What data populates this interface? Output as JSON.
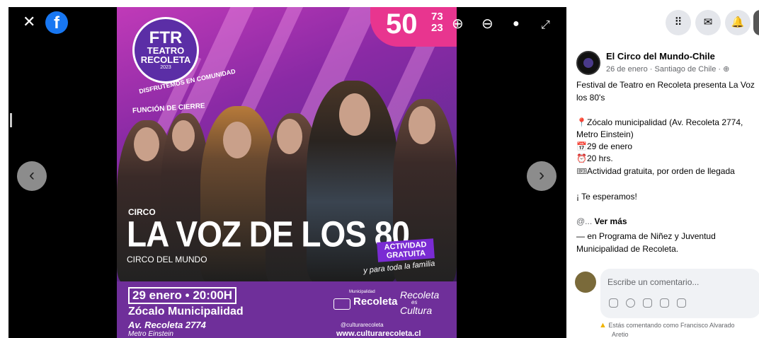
{
  "viewer": {
    "close_glyph": "✕",
    "facebook_glyph": "f",
    "zoom_in_glyph": "⊕",
    "zoom_out_glyph": "⊖",
    "tag_glyph": "●",
    "fullscreen_glyph": "⤢",
    "prev_glyph": "‹",
    "next_glyph": "›"
  },
  "poster": {
    "ftr": "FTR",
    "teatro": "TEATRO",
    "recoleta": "RECOLETA",
    "year": "2023",
    "comunidad": "DISFRUTEMOS EN COMUNIDAD",
    "funcion": "FUNCIÓN DE CIERRE",
    "badge_number": "50",
    "badge_years_top": "73",
    "badge_years_bottom": "23",
    "circo_small": "CIRCO",
    "headline": "LA VOZ DE LOS 80",
    "circo_mundo": "CIRCO DEL MUNDO",
    "actividad_line1": "ACTIVIDAD",
    "actividad_line2": "GRATUITA",
    "familia": "y para toda la familia",
    "date_time": "29 enero • 20:00H",
    "venue": "Zócalo Municipalidad",
    "address": "Av. Recoleta 2774",
    "metro": "Metro Einstein",
    "muni_small": "Municipalidad",
    "muni_name": "Recoleta",
    "recoleta_cultura_1": "Recoleta",
    "recoleta_cultura_2": "es",
    "recoleta_cultura_3": "Cultura",
    "social_handle": "@culturarecoleta",
    "website": "www.culturarecoleta.cl"
  },
  "sidebar": {
    "topbar": {
      "menu_glyph": "⠿",
      "messenger_glyph": "✉",
      "bell_glyph": "🔔"
    },
    "post": {
      "page_name": "El Circo del Mundo-Chile",
      "meta": "26 de enero · Santiago de Chile · ⊕",
      "line1": "Festival de Teatro en Recoleta presenta La Voz",
      "line2": "los 80's",
      "line3": "Zócalo municipalidad (Av. Recoleta 2774,",
      "line4": "Metro Einstein)",
      "line5": "29 de enero",
      "line6": "20 hrs.",
      "line7": "Actividad gratuita, por orden de llegada",
      "line8": "¡ Te esperamos!",
      "ver_prefix": "@...",
      "ver_mas": "Ver más",
      "tagged_line1": "— en Programa de Niñez y Juventud",
      "tagged_line2": "Municipalidad de Recoleta."
    },
    "comment": {
      "placeholder": "Escribe un comentario...",
      "warning_line1": "Estás comentando como Francisco Alvarado",
      "warning_line2": "Aretio"
    },
    "icons": {
      "pin": "📍",
      "calendar": "📅",
      "clock": "⏰",
      "ticket": "🎟"
    }
  }
}
